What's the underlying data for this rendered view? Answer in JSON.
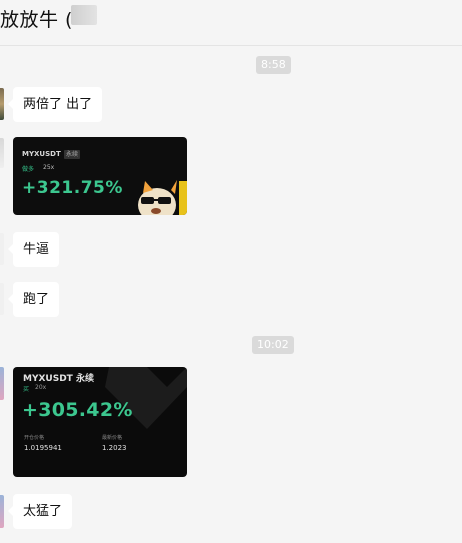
{
  "header": {
    "title": "放放牛 ("
  },
  "messages": {
    "time1": "8:58",
    "msg1": "两倍了 出了",
    "card1": {
      "pair": "MYXUSDT",
      "tag": "永续",
      "side": "做多",
      "leverage": "25x",
      "pnl": "+321.75%"
    },
    "msg2": "牛逼",
    "msg3": "跑了",
    "time2": "10:02",
    "card2": {
      "pair": "MYXUSDT 永续",
      "side": "买",
      "leverage": "20x",
      "pnl": "+305.42%",
      "open_label": "开仓价格",
      "open_price": "1.0195941",
      "latest_label": "最新价格",
      "latest_price": "1.2023"
    },
    "msg4": "太猛了"
  },
  "colors": {
    "profit_green": "#3cc78f",
    "card_bg": "#0d0d0d",
    "chat_bg": "#f5f5f5",
    "bubble": "#ffffff"
  }
}
